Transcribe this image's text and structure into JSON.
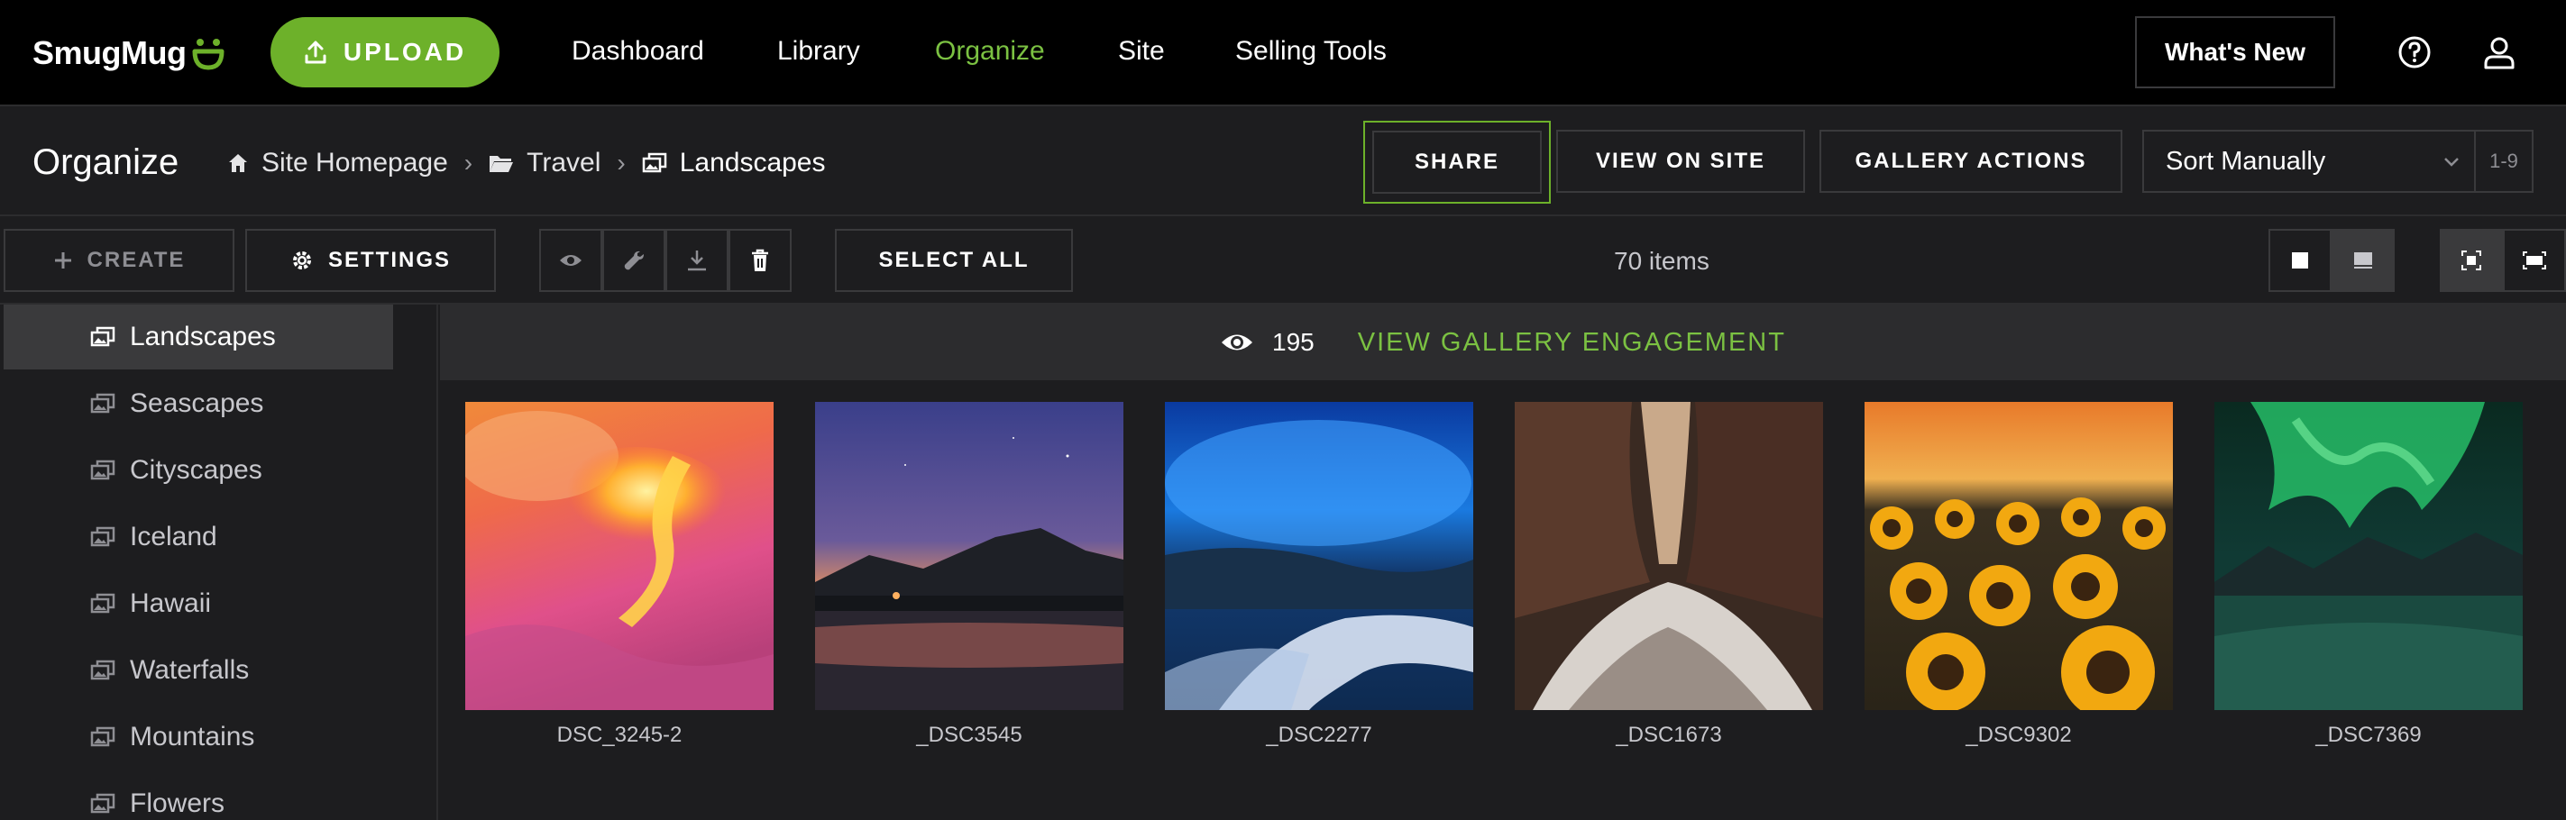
{
  "brand": {
    "name": "SmugMug",
    "accent": "#6db12a",
    "link_green": "#7bc142"
  },
  "topnav": {
    "upload_label": "UPLOAD",
    "links": [
      "Dashboard",
      "Library",
      "Organize",
      "Site",
      "Selling Tools"
    ],
    "active_link": "Organize",
    "whats_new_label": "What's New",
    "icons": [
      "upload-icon",
      "help-icon",
      "user-icon"
    ]
  },
  "header": {
    "title": "Organize",
    "breadcrumb": [
      "Site Homepage",
      "Travel",
      "Landscapes"
    ],
    "breadcrumb_icons": [
      "home-icon",
      "folder-icon",
      "gallery-icon"
    ],
    "share_label": "SHARE",
    "view_on_site_label": "VIEW ON SITE",
    "gallery_actions_label": "GALLERY ACTIONS",
    "sort_value": "Sort Manually",
    "range_label": "1-9"
  },
  "toolbar": {
    "create_label": "CREATE",
    "settings_label": "SETTINGS",
    "select_all_label": "SELECT ALL",
    "item_count": "70 items",
    "tool_icons": [
      "eye-icon",
      "wrench-icon",
      "download-icon",
      "trash-icon"
    ],
    "view_icons": [
      "small-square-view-icon",
      "large-thumb-view-icon",
      "fit-view-icon",
      "fill-view-icon"
    ]
  },
  "sidebar": {
    "items": [
      {
        "label": "Landscapes",
        "active": true
      },
      {
        "label": "Seascapes",
        "active": false
      },
      {
        "label": "Cityscapes",
        "active": false
      },
      {
        "label": "Iceland",
        "active": false
      },
      {
        "label": "Hawaii",
        "active": false
      },
      {
        "label": "Waterfalls",
        "active": false
      },
      {
        "label": "Mountains",
        "active": false
      },
      {
        "label": "Flowers",
        "active": false
      }
    ]
  },
  "gallery": {
    "view_count": "195",
    "engagement_label": "VIEW GALLERY ENGAGEMENT",
    "photos": [
      {
        "caption": "DSC_3245-2"
      },
      {
        "caption": "_DSC3545"
      },
      {
        "caption": "_DSC2277"
      },
      {
        "caption": "_DSC1673"
      },
      {
        "caption": "_DSC9302"
      },
      {
        "caption": "_DSC7369"
      }
    ]
  }
}
